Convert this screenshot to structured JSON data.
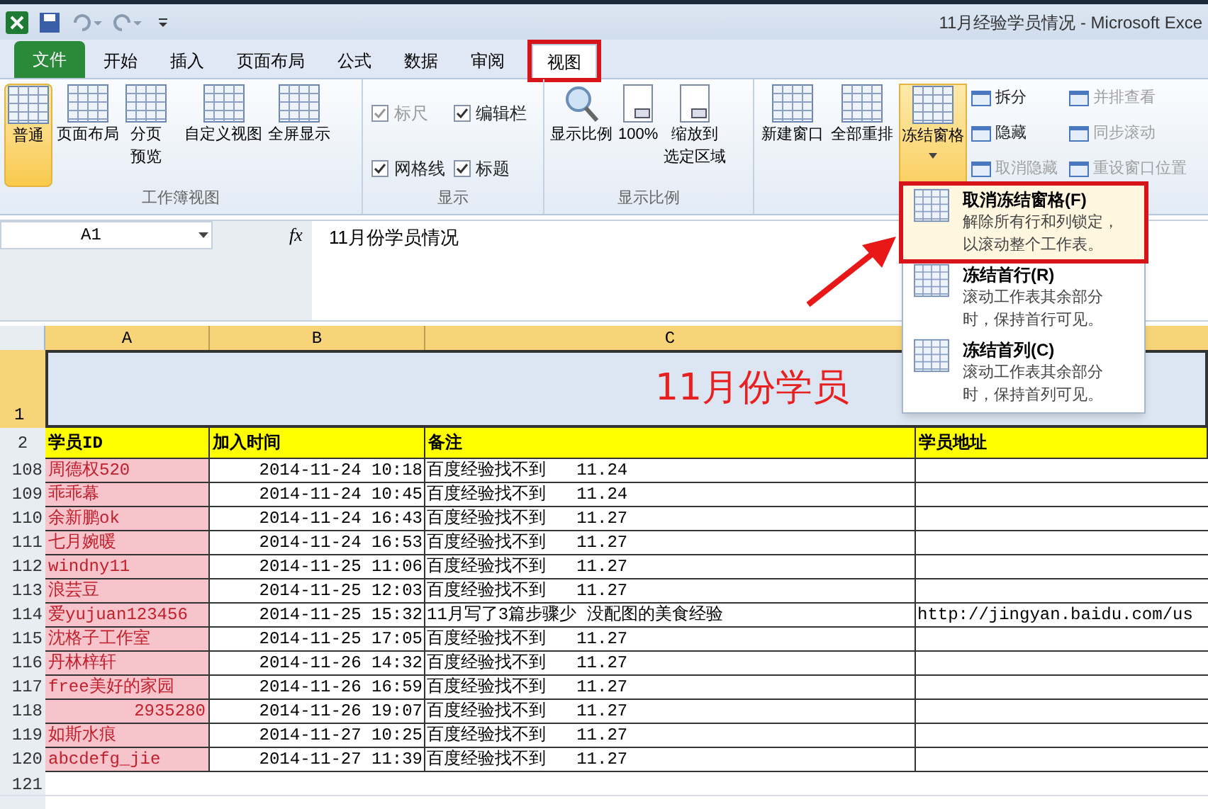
{
  "window": {
    "title": "11月经验学员情况 - Microsoft Exce"
  },
  "tabs": [
    {
      "label": "文件",
      "kind": "file",
      "selected": false
    },
    {
      "label": "开始",
      "kind": "tab",
      "selected": false
    },
    {
      "label": "插入",
      "kind": "tab",
      "selected": false
    },
    {
      "label": "页面布局",
      "kind": "tab",
      "selected": false
    },
    {
      "label": "公式",
      "kind": "tab",
      "selected": false
    },
    {
      "label": "数据",
      "kind": "tab",
      "selected": false
    },
    {
      "label": "审阅",
      "kind": "tab",
      "selected": false
    },
    {
      "label": "视图",
      "kind": "tab",
      "selected": true
    }
  ],
  "ribbon": {
    "workbook_views": {
      "label": "工作簿视图",
      "buttons": [
        {
          "label": "普通",
          "selected": true
        },
        {
          "label": "页面布局",
          "selected": false
        },
        {
          "label": [
            "分页",
            "预览"
          ],
          "selected": false
        },
        {
          "label": "自定义视图",
          "selected": false
        },
        {
          "label": "全屏显示",
          "selected": false
        }
      ]
    },
    "show": {
      "label": "显示",
      "checkboxes": [
        {
          "label": "标尺",
          "checked": true,
          "disabled": true
        },
        {
          "label": "编辑栏",
          "checked": true,
          "disabled": false
        },
        {
          "label": "网格线",
          "checked": true,
          "disabled": false
        },
        {
          "label": "标题",
          "checked": true,
          "disabled": false
        }
      ]
    },
    "zoom": {
      "label": "显示比例",
      "buttons": [
        [
          "显示比例"
        ],
        [
          "100%"
        ],
        [
          "缩放到",
          "选定区域"
        ]
      ]
    },
    "window": {
      "buttons": [
        {
          "label": "新建窗口",
          "selected": false
        },
        {
          "label": "全部重排",
          "selected": false
        },
        {
          "label": "冻结窗格",
          "selected": true
        }
      ],
      "small_buttons": [
        {
          "label": "拆分",
          "disabled": false
        },
        {
          "label": "隐藏",
          "disabled": false
        },
        {
          "label": "取消隐藏",
          "disabled": true
        },
        {
          "label": "并排查看",
          "disabled": true
        },
        {
          "label": "同步滚动",
          "disabled": true
        },
        {
          "label": "重设窗口位置",
          "disabled": true
        }
      ]
    }
  },
  "formula_bar": {
    "name_box": "A1",
    "fx": "fx",
    "value": "11月份学员情况"
  },
  "sheet": {
    "columns": [
      "A",
      "B",
      "C"
    ],
    "title_row": {
      "number": "1",
      "text": "11月份学员"
    },
    "header_row": {
      "number": "2",
      "cells": [
        "学员ID",
        "加入时间",
        "备注",
        "学员地址"
      ]
    },
    "rows": [
      {
        "number": "108",
        "id": "周德权520",
        "kind": "text",
        "time": "2014-11-24 10:18",
        "note": "百度经验找不到   11.24"
      },
      {
        "number": "109",
        "id": "乖乖幕",
        "kind": "text",
        "time": "2014-11-24 10:45",
        "note": "百度经验找不到   11.24"
      },
      {
        "number": "110",
        "id": "余新鹏ok",
        "kind": "text",
        "time": "2014-11-24 16:43",
        "note": "百度经验找不到   11.27"
      },
      {
        "number": "111",
        "id": "七月婉暖",
        "kind": "text",
        "time": "2014-11-24 16:53",
        "note": "百度经验找不到   11.27"
      },
      {
        "number": "112",
        "id": "windny11",
        "kind": "text",
        "time": "2014-11-25 11:06",
        "note": "百度经验找不到   11.27"
      },
      {
        "number": "113",
        "id": "浪芸豆",
        "kind": "text",
        "time": "2014-11-25 12:03",
        "note": "百度经验找不到   11.27"
      },
      {
        "number": "114",
        "id": "爱yujuan123456",
        "kind": "text",
        "time": "2014-11-25 15:32",
        "note": "11月写了3篇步骤少 没配图的美食经验",
        "address": "http://jingyan.baidu.com/us"
      },
      {
        "number": "115",
        "id": "沈格子工作室",
        "kind": "text",
        "time": "2014-11-25 17:05",
        "note": "百度经验找不到   11.27"
      },
      {
        "number": "116",
        "id": "丹林梓轩",
        "kind": "text",
        "time": "2014-11-26 14:32",
        "note": "百度经验找不到   11.27"
      },
      {
        "number": "117",
        "id": "free美好的家园",
        "kind": "text",
        "time": "2014-11-26 16:59",
        "note": "百度经验找不到   11.27"
      },
      {
        "number": "118",
        "id": "2935280",
        "kind": "number",
        "time": "2014-11-26 19:07",
        "note": "百度经验找不到   11.27"
      },
      {
        "number": "119",
        "id": "如斯水痕",
        "kind": "text",
        "time": "2014-11-27 10:25",
        "note": "百度经验找不到   11.27"
      },
      {
        "number": "120",
        "id": "abcdefg_jie",
        "kind": "text",
        "time": "2014-11-27 11:39",
        "note": "百度经验找不到   11.27"
      }
    ],
    "empty_rows": [
      "121"
    ]
  },
  "dropdown": [
    {
      "title": "取消冻结窗格(F)",
      "description": [
        "解除所有行和列锁定，",
        "以滚动整个工作表。"
      ],
      "selected": true
    },
    {
      "title": "冻结首行(R)",
      "description": [
        "滚动工作表其余部分",
        "时，保持首行可见。"
      ],
      "selected": false
    },
    {
      "title": "冻结首列(C)",
      "description": [
        "滚动工作表其余部分",
        "时，保持首列可见。"
      ],
      "selected": false
    }
  ]
}
